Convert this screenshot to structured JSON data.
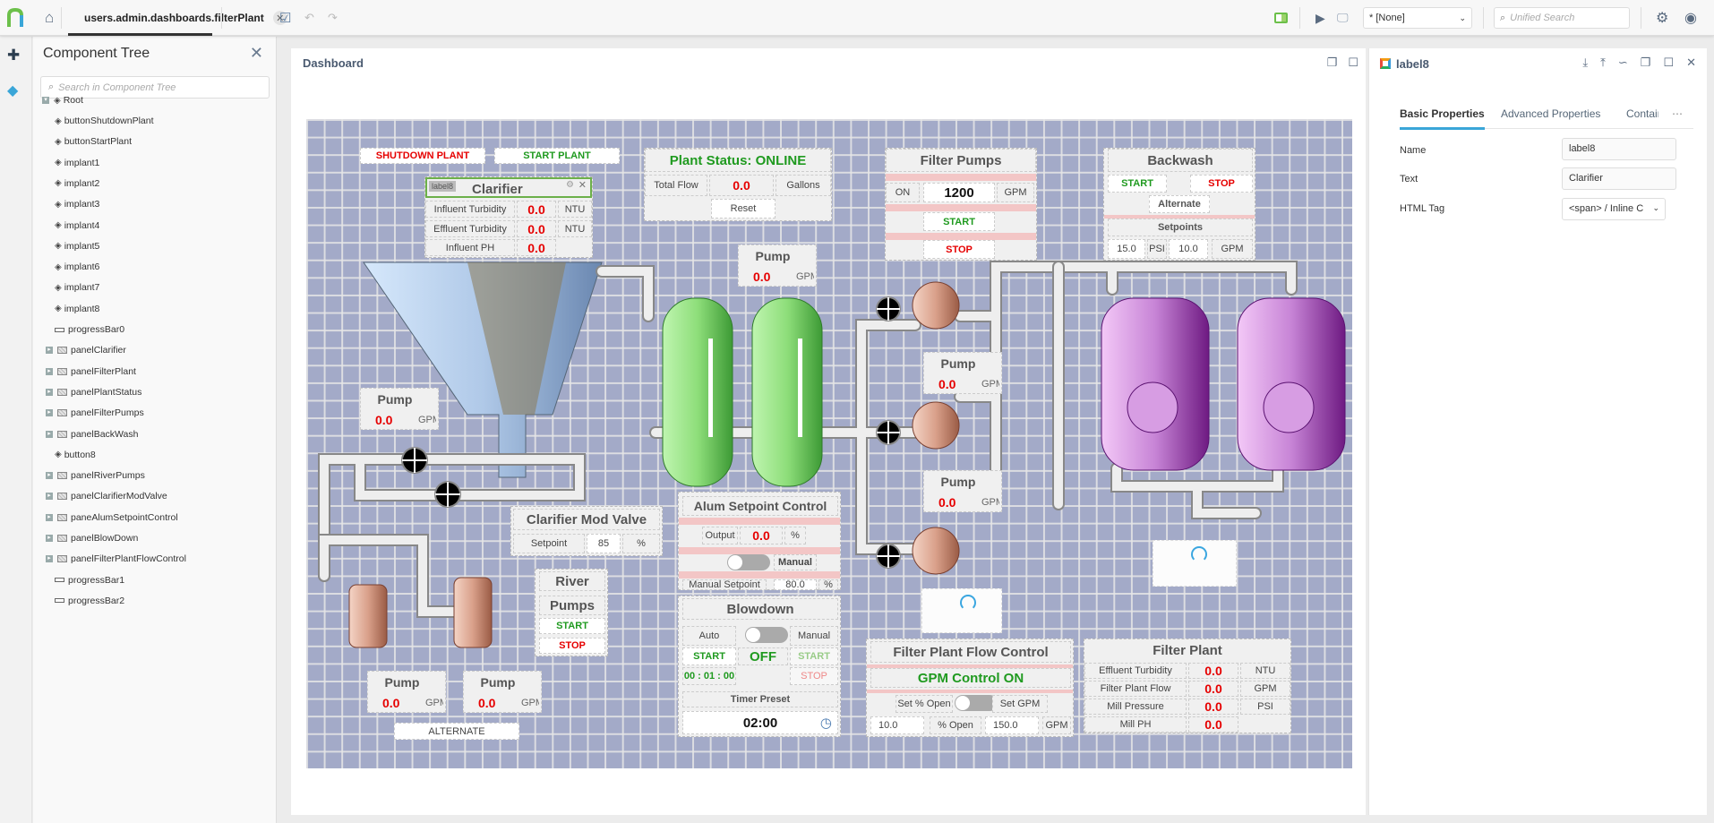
{
  "topbar": {
    "tab_label": "users.admin.dashboards.filterPlant",
    "project_select": "* [None]",
    "search_placeholder": "Unified Search"
  },
  "tree": {
    "title": "Component Tree",
    "search_placeholder": "Search in Component Tree",
    "root": "Root",
    "items": [
      {
        "label": "buttonShutdownPlant",
        "type": "component"
      },
      {
        "label": "buttonStartPlant",
        "type": "component"
      },
      {
        "label": "implant1",
        "type": "component"
      },
      {
        "label": "implant2",
        "type": "component"
      },
      {
        "label": "implant3",
        "type": "component"
      },
      {
        "label": "implant4",
        "type": "component"
      },
      {
        "label": "implant5",
        "type": "component"
      },
      {
        "label": "implant6",
        "type": "component"
      },
      {
        "label": "implant7",
        "type": "component"
      },
      {
        "label": "implant8",
        "type": "component"
      },
      {
        "label": "progressBar0",
        "type": "bar"
      },
      {
        "label": "panelClarifier",
        "type": "panel"
      },
      {
        "label": "panelFilterPlant",
        "type": "panel"
      },
      {
        "label": "panelPlantStatus",
        "type": "panel"
      },
      {
        "label": "panelFilterPumps",
        "type": "panel"
      },
      {
        "label": "panelBackWash",
        "type": "panel"
      },
      {
        "label": "button8",
        "type": "component"
      },
      {
        "label": "panelRiverPumps",
        "type": "panel"
      },
      {
        "label": "panelClarifierModValve",
        "type": "panel"
      },
      {
        "label": "paneAlumSetpointControl",
        "type": "panel"
      },
      {
        "label": "panelBlowDown",
        "type": "panel"
      },
      {
        "label": "panelFilterPlantFlowControl",
        "type": "panel"
      },
      {
        "label": "progressBar1",
        "type": "bar"
      },
      {
        "label": "progressBar2",
        "type": "bar"
      }
    ]
  },
  "dashboard": {
    "title": "Dashboard",
    "shutdown": "SHUTDOWN PLANT",
    "start": "START PLANT",
    "clarifier": {
      "tag": "label8",
      "title": "Clarifier",
      "rows": [
        {
          "label": "Influent Turbidity",
          "value": "0.0",
          "unit": "NTU"
        },
        {
          "label": "Effluent Turbidity",
          "value": "0.0",
          "unit": "NTU"
        },
        {
          "label": "Influent PH",
          "value": "0.0",
          "unit": ""
        }
      ]
    },
    "status": {
      "title": "Plant Status: ONLINE",
      "flow_label": "Total Flow",
      "flow_value": "0.0",
      "flow_unit": "Gallons",
      "reset": "Reset"
    },
    "filter_pumps": {
      "title": "Filter Pumps",
      "state": "ON",
      "value": "1200",
      "unit": "GPM",
      "start": "START",
      "stop": "STOP"
    },
    "backwash": {
      "title": "Backwash",
      "start": "START",
      "stop": "STOP",
      "alternate": "Alternate",
      "setpoints": "Setpoints",
      "psi_value": "15.0",
      "psi_unit": "PSI",
      "gpm_value": "10.0",
      "gpm_unit": "GPM"
    },
    "pumps": [
      {
        "title": "Pump",
        "value": "0.0",
        "unit": "GPM"
      },
      {
        "title": "Pump",
        "value": "0.0",
        "unit": "GPM"
      },
      {
        "title": "Pump",
        "value": "0.0",
        "unit": "GPM"
      },
      {
        "title": "Pump",
        "value": "0.0",
        "unit": "GPM"
      },
      {
        "title": "Pump",
        "value": "0.0",
        "unit": "GPM"
      },
      {
        "title": "Pump",
        "value": "0.0",
        "unit": "GPM"
      }
    ],
    "mod_valve": {
      "title": "Clarifier Mod Valve",
      "label": "Setpoint",
      "value": "85",
      "unit": "%"
    },
    "river": {
      "title1": "River",
      "title2": "Pumps",
      "start": "START",
      "stop": "STOP"
    },
    "alternate": "ALTERNATE",
    "alum": {
      "title": "Alum Setpoint Control",
      "output_label": "Output",
      "output_value": "0.0",
      "output_unit": "%",
      "manual": "Manual",
      "setpoint_label": "Manual Setpoint",
      "setpoint_value": "80.0",
      "setpoint_unit": "%"
    },
    "blowdown": {
      "title": "Blowdown",
      "auto": "Auto",
      "manual": "Manual",
      "start_auto": "START",
      "state": "OFF",
      "start_manual": "START",
      "timer": "00 : 01 : 00",
      "stop": "STOP",
      "preset_label": "Timer Preset",
      "preset_value": "02:00"
    },
    "flow_control": {
      "title": "Filter Plant Flow Control",
      "state": "GPM Control ON",
      "set_open": "Set % Open",
      "set_gpm": "Set GPM",
      "open_value": "10.0",
      "open_unit": "% Open",
      "gpm_value": "150.0",
      "gpm_unit": "GPM"
    },
    "filter_plant": {
      "title": "Filter Plant",
      "rows": [
        {
          "label": "Effluent Turbidity",
          "value": "0.0",
          "unit": "NTU"
        },
        {
          "label": "Filter Plant Flow",
          "value": "0.0",
          "unit": "GPM"
        },
        {
          "label": "Mill Pressure",
          "value": "0.0",
          "unit": "PSI"
        },
        {
          "label": "Mill PH",
          "value": "0.0",
          "unit": ""
        }
      ]
    }
  },
  "props": {
    "title": "label8",
    "tabs": [
      "Basic Properties",
      "Advanced Properties",
      "Contain"
    ],
    "name_label": "Name",
    "name_value": "label8",
    "text_label": "Text",
    "text_value": "Clarifier",
    "tag_label": "HTML Tag",
    "tag_value": "<span> / Inline C"
  },
  "colors": {
    "accent": "#3aa6d8",
    "value_red": "#e60000",
    "ok_green": "#1f9a1f",
    "canvas": "#a3aac8"
  }
}
